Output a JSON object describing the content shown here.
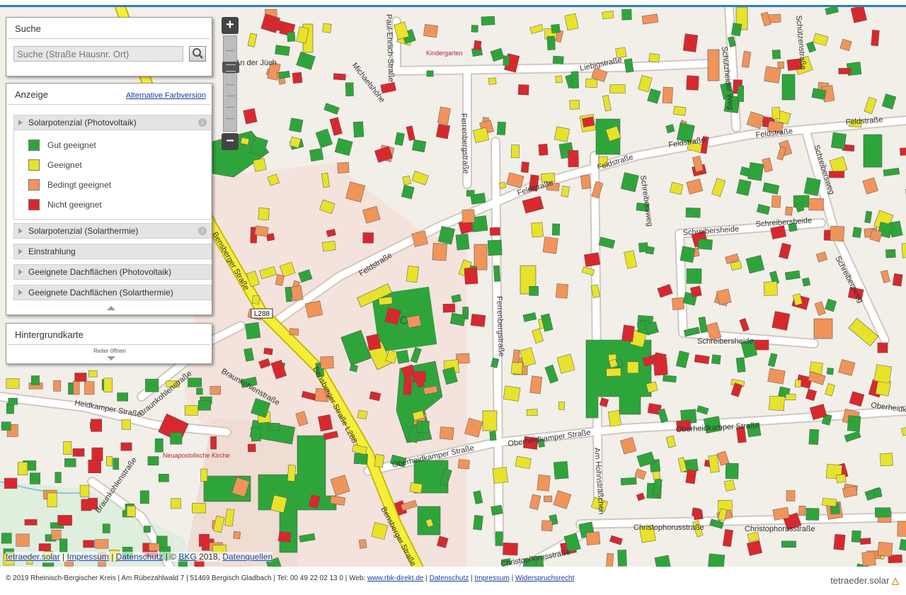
{
  "search": {
    "title": "Suche",
    "placeholder": "Suche (Straße Hausnr. Ort)"
  },
  "legend": {
    "title": "Anzeige",
    "alt_link": "Alternative Farbversion",
    "layers": [
      {
        "label": "Solarpotenzial (Photovoltaik)",
        "expanded": true
      },
      {
        "label": "Solarpotenzial (Solarthermie)"
      },
      {
        "label": "Einstrahlung"
      },
      {
        "label": "Geeignete Dachflächen (Photovoltaik)"
      },
      {
        "label": "Geeignete Dachflächen (Solarthermie)"
      }
    ],
    "items": [
      {
        "label": "Gut geeignet",
        "color": "#2ea53a"
      },
      {
        "label": "Geeignet",
        "color": "#e8e22a"
      },
      {
        "label": "Bedingt geeignet",
        "color": "#f0945a"
      },
      {
        "label": "Nicht geeignet",
        "color": "#d9282d"
      }
    ]
  },
  "background_panel": {
    "title": "Hintergrundkarte",
    "open_label": "Reiter öffnen"
  },
  "zoom": {
    "in": "+",
    "out": "−"
  },
  "map": {
    "road_shield": "L288",
    "streets": [
      "Feldstraße",
      "Schreibersheide",
      "Schreibersweg",
      "Oberheidkamper Straße",
      "Heidkamper Straße",
      "Braunkohlenstraße",
      "Bensberger Straße",
      "Bensberger Straße L288",
      "Ferrenbergstraße",
      "Liebigstraße",
      "Schützenstraße",
      "Schützheider Weg",
      "Christophorusstraße",
      "Am Hohnsträßchen",
      "Michaelshöhe",
      "Paul-Ehrlich-Straße",
      "An der Jüch",
      "Feldstraße"
    ],
    "places": [
      "Kindergarten",
      "Neuapostolische Kirche"
    ]
  },
  "attribution": {
    "tetraeder": "tetraeder.solar",
    "impressum": "Impressum",
    "datenschutz": "Datenschutz",
    "copy": "© ",
    "bkg": "BKG",
    "year": " 2018, ",
    "datenquellen": "Datenquellen"
  },
  "footer": {
    "text": "© 2019 Rheinisch-Bergischer Kreis | Am Rübezahlwald 7 | 51469 Bergisch Gladbach | Tel: 00 49 22 02 13 0 | Web: ",
    "web": "www.rbk-direkt.de",
    "datenschutz": "Datenschutz",
    "impressum": "Impressum",
    "widerspruch": "Widerspruchsrecht",
    "logo": "tetraeder.solar"
  }
}
